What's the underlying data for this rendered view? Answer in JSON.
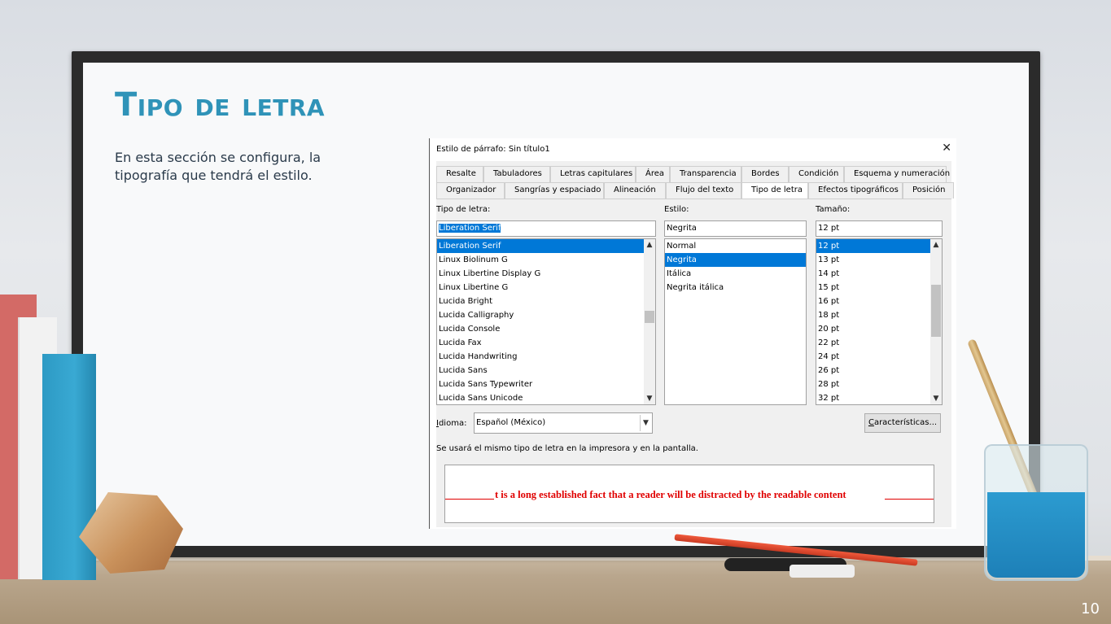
{
  "slide": {
    "title": "Tipo de letra",
    "body": "En esta sección se configura, la tipografía que tendrá el estilo.",
    "page_number": "10"
  },
  "dialog": {
    "title": "Estilo de párrafo: Sin título1",
    "close_glyph": "✕",
    "tabs_row1": [
      "Resalte",
      "Tabuladores",
      "Letras capitulares",
      "Área",
      "Transparencia",
      "Bordes",
      "Condición",
      "Esquema y numeración"
    ],
    "tabs_row2": [
      "Organizador",
      "Sangrías y espaciado",
      "Alineación",
      "Flujo del texto",
      "Tipo de letra",
      "Efectos tipográficos",
      "Posición"
    ],
    "active_tab": "Tipo de letra",
    "font_label": "Tipo de letra:",
    "font_value": "Liberation Serif",
    "font_list": [
      "Liberation Serif",
      "Linux Biolinum G",
      "Linux Libertine Display G",
      "Linux Libertine G",
      "Lucida Bright",
      "Lucida Calligraphy",
      "Lucida Console",
      "Lucida Fax",
      "Lucida Handwriting",
      "Lucida Sans",
      "Lucida Sans Typewriter",
      "Lucida Sans Unicode"
    ],
    "font_selected": "Liberation Serif",
    "style_label": "Estilo:",
    "style_value": "Negrita",
    "style_list": [
      "Normal",
      "Negrita",
      "Itálica",
      "Negrita itálica"
    ],
    "style_selected": "Negrita",
    "size_label": "Tamaño:",
    "size_value": "12 pt",
    "size_list": [
      "12 pt",
      "13 pt",
      "14 pt",
      "15 pt",
      "16 pt",
      "18 pt",
      "20 pt",
      "22 pt",
      "24 pt",
      "26 pt",
      "28 pt",
      "32 pt"
    ],
    "size_selected": "12 pt",
    "language_label_prefix": "I",
    "language_label_rest": "dioma:",
    "language_value": "Español (México)",
    "features_button": "Características...",
    "features_button_prefix": "C",
    "features_button_rest": "aracterísticas...",
    "info_text": "Se usará el mismo tipo de letra en la impresora y en la pantalla.",
    "preview_text": "t is a long established fact that a reader will be distracted by the readable content",
    "preview_color": "#e00000"
  },
  "colors": {
    "title": "#2f93b8",
    "selection": "#0078d7"
  }
}
